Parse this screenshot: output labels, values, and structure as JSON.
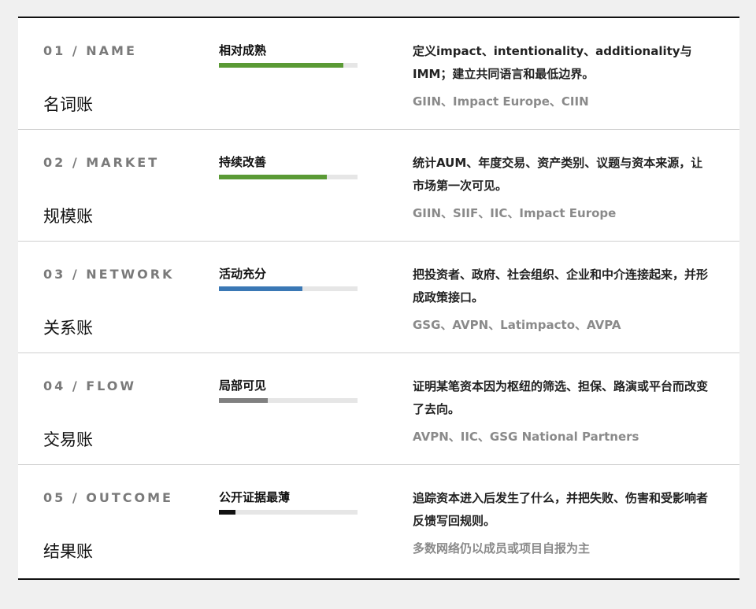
{
  "rows": [
    {
      "code": "01 / NAME",
      "name": "名词账",
      "status": "相对成熟",
      "progress": 0.9,
      "bar_color": "#5a9a35",
      "description": "定义impact、intentionality、additionality与IMM；建立共同语言和最低边界。",
      "orgs": "GIIN、Impact Europe、CIIN"
    },
    {
      "code": "02 / MARKET",
      "name": "规模账",
      "status": "持续改善",
      "progress": 0.78,
      "bar_color": "#5a9a35",
      "description": "统计AUM、年度交易、资产类别、议题与资本来源，让市场第一次可见。",
      "orgs": "GIIN、SIIF、IIC、Impact Europe"
    },
    {
      "code": "03 / NETWORK",
      "name": "关系账",
      "status": "活动充分",
      "progress": 0.6,
      "bar_color": "#3a78b5",
      "description": "把投资者、政府、社会组织、企业和中介连接起来，并形成政策接口。",
      "orgs": "GSG、AVPN、Latimpacto、AVPA"
    },
    {
      "code": "04 / FLOW",
      "name": "交易账",
      "status": "局部可见",
      "progress": 0.35,
      "bar_color": "#808080",
      "description": "证明某笔资本因为枢纽的筛选、担保、路演或平台而改变了去向。",
      "orgs": "AVPN、IIC、GSG National Partners"
    },
    {
      "code": "05 / OUTCOME",
      "name": "结果账",
      "status": "公开证据最薄",
      "progress": 0.12,
      "bar_color": "#111111",
      "description": "追踪资本进入后发生了什么，并把失败、伤害和受影响者反馈写回规则。",
      "orgs": "多数网络仍以成员或项目自报为主"
    }
  ]
}
